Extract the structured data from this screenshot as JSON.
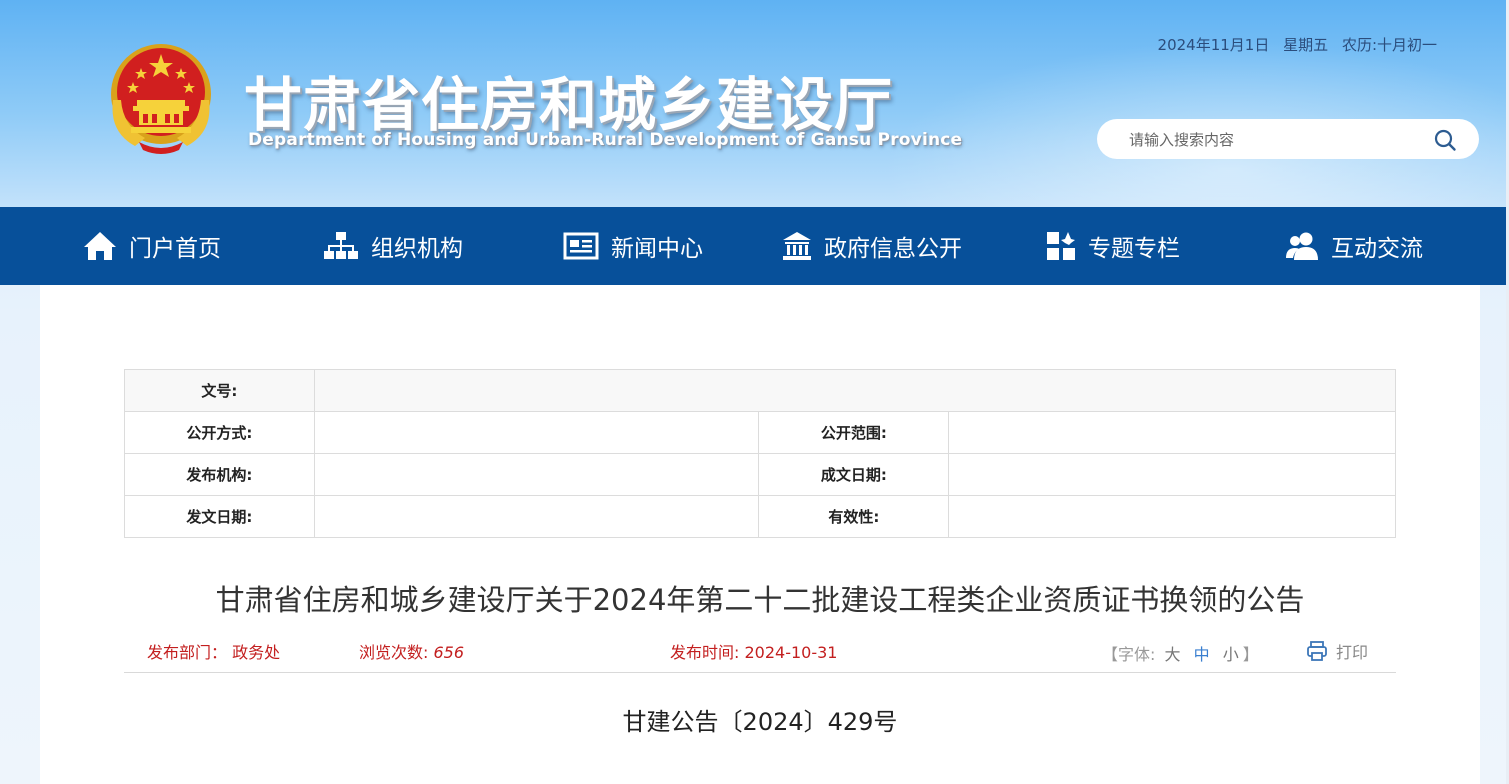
{
  "header": {
    "title": "甘肃省住房和城乡建设厅",
    "subtitle": "Department of Housing and Urban-Rural Development of Gansu Province",
    "date": "2024年11月1日",
    "weekday": "星期五",
    "lunar": "农历:十月初一",
    "search": {
      "placeholder": "请输入搜索内容",
      "value": "",
      "icon": "search-icon"
    },
    "emblem": "national-emblem"
  },
  "nav": {
    "items": [
      {
        "label": "门户首页",
        "icon": "home-icon"
      },
      {
        "label": "组织机构",
        "icon": "org-chart-icon"
      },
      {
        "label": "新闻中心",
        "icon": "newspaper-icon"
      },
      {
        "label": "政府信息公开",
        "icon": "government-building-icon"
      },
      {
        "label": "专题专栏",
        "icon": "grid-star-icon"
      },
      {
        "label": "互动交流",
        "icon": "users-icon"
      }
    ]
  },
  "meta_table": {
    "doc_no_label": "文号:",
    "doc_no_value": "",
    "rows": [
      {
        "label1": "公开方式:",
        "value1": "",
        "label2": "公开范围:",
        "value2": ""
      },
      {
        "label1": "发布机构:",
        "value1": "",
        "label2": "成文日期:",
        "value2": ""
      },
      {
        "label1": "发文日期:",
        "value1": "",
        "label2": "有效性:",
        "value2": ""
      }
    ]
  },
  "article": {
    "title": "甘肃省住房和城乡建设厅关于2024年第二十二批建设工程类企业资质证书换领的公告",
    "dept_label": "发布部门：",
    "dept_value": "政务处",
    "views_label": "浏览次数:",
    "views_value": "656",
    "time_label": "发布时间:",
    "time_value": "2024-10-31",
    "font_bracket_open": "【",
    "font_label": "字体:",
    "font_sizes": [
      "大",
      "中",
      "小"
    ],
    "font_bracket_close": "】",
    "print_label": "打印",
    "doc_number": "甘建公告〔2024〕429号"
  },
  "colors": {
    "nav_bg": "#07509a",
    "info_red": "#c31f1f",
    "header_blue": "#5fb2f3",
    "active_font": "#3a7fd0"
  }
}
